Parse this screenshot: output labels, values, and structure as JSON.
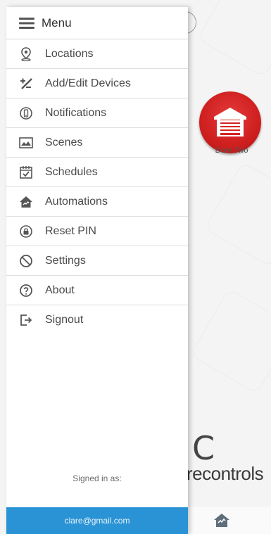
{
  "menu": {
    "title": "Menu",
    "items": [
      {
        "label": "Locations",
        "icon": "location-pin-icon"
      },
      {
        "label": "Add/Edit Devices",
        "icon": "add-edit-icon"
      },
      {
        "label": "Notifications",
        "icon": "notification-icon"
      },
      {
        "label": "Scenes",
        "icon": "scenes-icon"
      },
      {
        "label": "Schedules",
        "icon": "calendar-icon"
      },
      {
        "label": "Automations",
        "icon": "home-automation-icon"
      },
      {
        "label": "Reset PIN",
        "icon": "lock-icon"
      },
      {
        "label": "Settings",
        "icon": "settings-icon"
      },
      {
        "label": "About",
        "icon": "help-icon"
      },
      {
        "label": "Signout",
        "icon": "signout-icon"
      }
    ]
  },
  "account": {
    "signed_in_label": "Signed in as:",
    "email": "clare@gmail.com"
  },
  "background": {
    "device": {
      "label": "Door Two",
      "icon": "garage-door-icon",
      "color": "#d42424"
    },
    "brand_wordmark": "recontrols",
    "brand_glyph": "C"
  },
  "colors": {
    "accent": "#2a93d5",
    "device_red": "#d42424"
  }
}
